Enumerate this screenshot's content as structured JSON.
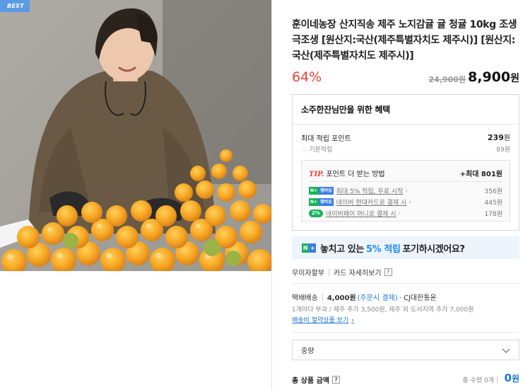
{
  "photo": {
    "badge": "BEST"
  },
  "product": {
    "title": "훈이네농장 산지직송 제주 노지감귤 귤 청귤 10kg 조생 극조생 [원산지:국산(제주특별자치도 제주시)] [원산지:국산(제주특별자치도 제주시)]",
    "discount": "64%",
    "original_price": "24,900원",
    "price": "8,900",
    "price_unit": "원"
  },
  "benefits": {
    "title": "소주한잔님만을 위한 혜택",
    "max_label": "최대 적립 포인트",
    "max_value": "239",
    "max_unit": "원",
    "base_label": "기본적립",
    "base_value": "89원",
    "tip_prefix": "TIP.",
    "tip_title": "포인트 더 받는 방법",
    "tip_value": "+최대 801원",
    "tip_rows": [
      {
        "badge": "N+멤버십",
        "text": "최대 5% 적립, 무료 시작",
        "amount": "356원"
      },
      {
        "badge": "N+멤버십",
        "text": "네이버 현대카드로 결제 시",
        "amount": "445원"
      },
      {
        "badge": "2%",
        "text": "네이버페이 머니로 결제 시",
        "amount": "178원"
      }
    ]
  },
  "promo": {
    "pre": "놓치고 있는",
    "highlight": "5% 적립",
    "post": "포기하시겠어요?"
  },
  "installment": {
    "label": "무이자할부",
    "link": "카드 자세히보기",
    "help": "?"
  },
  "shipping": {
    "label": "택배배송",
    "fee": "4,000원",
    "fee_note": "(주문시 결제)",
    "carrier": "· CJ대한통운",
    "extra": "1개마다 부과 / 제주 추가 3,500원, 제주 외 도서지역 추가 7,000원",
    "saving_link": "배송비 절약상품 보기"
  },
  "option_select": {
    "value": "중량"
  },
  "total": {
    "label": "총 상품 금액",
    "help": "?",
    "qty": "총 수량 0개",
    "amount": "0",
    "unit": "원"
  },
  "colors": {
    "accent_red": "#e8413c",
    "accent_blue": "#1e73d2",
    "promo_bg": "#eef4fc",
    "naver_green": "#19b35f"
  }
}
